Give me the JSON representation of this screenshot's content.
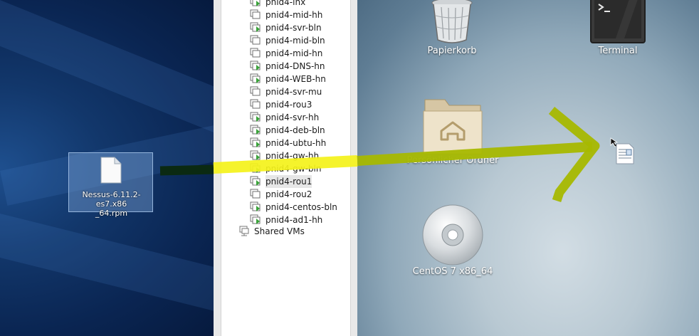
{
  "windows_desktop": {
    "selected_file": {
      "name_line1": "Nessus-6.11.2-es7.x86",
      "name_line2": "_64.rpm"
    }
  },
  "vm_library": {
    "items": [
      {
        "label": "pnid4-lnx",
        "state": "powered-on"
      },
      {
        "label": "pnid4-mid-hh",
        "state": "powered-off"
      },
      {
        "label": "pnid4-svr-bln",
        "state": "powered-on"
      },
      {
        "label": "pnid4-mid-bln",
        "state": "powered-off"
      },
      {
        "label": "pnid4-mid-hn",
        "state": "powered-off"
      },
      {
        "label": "pnid4-DNS-hn",
        "state": "powered-on"
      },
      {
        "label": "pnid4-WEB-hn",
        "state": "powered-on"
      },
      {
        "label": "pnid4-svr-mu",
        "state": "powered-off"
      },
      {
        "label": "pnid4-rou3",
        "state": "powered-off"
      },
      {
        "label": "pnid4-svr-hh",
        "state": "powered-on"
      },
      {
        "label": "pnid4-deb-bln",
        "state": "powered-on"
      },
      {
        "label": "pnid4-ubtu-hh",
        "state": "powered-on"
      },
      {
        "label": "pnid4-gw-hh",
        "state": "powered-on"
      },
      {
        "label": "pnid4-gw-bln",
        "state": "powered-on"
      },
      {
        "label": "pnid4-rou1",
        "state": "powered-on",
        "selected": true
      },
      {
        "label": "pnid4-rou2",
        "state": "powered-off"
      },
      {
        "label": "pnid4-centos-bln",
        "state": "powered-on"
      },
      {
        "label": "pnid4-ad1-hh",
        "state": "powered-on"
      }
    ],
    "shared_vms_label": "Shared VMs"
  },
  "centos_desktop": {
    "trash_label": "Papierkorb",
    "terminal_label": "Terminal",
    "home_label": "Persönlicher Ordner",
    "disc_label": "CentOS 7 x86_64"
  },
  "colors": {
    "highlight_yellow": "#f4f21a",
    "arrow_olive": "#a6b800",
    "selection_blue": "#5b86b8"
  },
  "icons": {
    "file": "document-icon",
    "vm_on": "vm-running-icon",
    "vm_off": "vm-stopped-icon",
    "shared": "shared-vms-icon",
    "trash": "trash-icon",
    "terminal": "terminal-icon",
    "home": "home-folder-icon",
    "disc": "dvd-icon",
    "cursor": "drag-copy-cursor-icon"
  }
}
